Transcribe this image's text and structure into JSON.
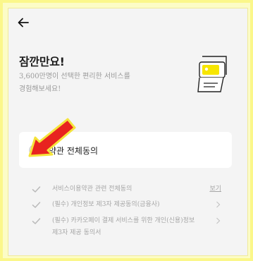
{
  "header": {
    "back_icon": "arrow-left-icon"
  },
  "intro": {
    "title": "잠깐만요!",
    "subtitle": "3,600만명이 선택한 편리한 서비스를\n경험해보세요!",
    "illustration": "payment-device-icon"
  },
  "agree_all": {
    "label": "약관 전체동의",
    "checked": false,
    "icon": "check-circle-icon"
  },
  "terms": [
    {
      "label": "서비스이용약관 관련 전체동의",
      "action": "보기",
      "checked": false
    },
    {
      "label": "(필수) 개인정보 제3자 제공동의(금융사)",
      "action": "chevron-right-icon",
      "checked": false
    },
    {
      "label": "(필수) 카카오페이 결제 서비스를 위한 개인(신용)정보\n제3자 제공 동의서",
      "action": "chevron-right-icon",
      "checked": false
    }
  ],
  "annotation": {
    "icon": "red-pointer-arrow-icon"
  },
  "colors": {
    "frame_border": "#fbf78a",
    "panel_bg": "#f4f4f4",
    "title_text": "#1e1e1e",
    "muted_text": "#a6a6a6",
    "device_accent": "#f7e600",
    "arrow_red": "#e8231f",
    "arrow_outline": "#f5e33a"
  }
}
